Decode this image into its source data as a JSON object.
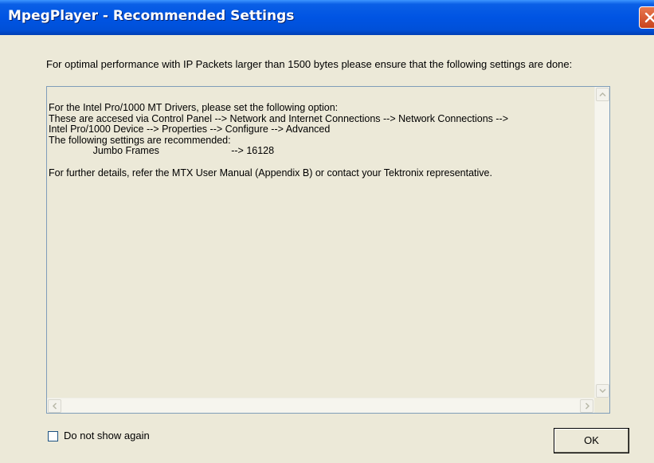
{
  "window": {
    "title": "MpegPlayer - Recommended Settings"
  },
  "message": "For optimal performance with IP Packets larger than 1500 bytes please ensure that the following settings are done:",
  "details": {
    "lines": [
      "For the Intel Pro/1000 MT Drivers, please set the following option:",
      "These are accesed via Control Panel --> Network and Internet Connections --> Network Connections -->",
      "Intel Pro/1000 Device --> Properties --> Configure --> Advanced",
      "The following settings are recommended:",
      "                Jumbo Frames                          --> 16128",
      "",
      "For further details, refer the MTX User Manual (Appendix B) or contact your Tektronix representative."
    ]
  },
  "checkbox": {
    "label": "Do not show again",
    "checked": false
  },
  "ok_button": {
    "label": "OK"
  },
  "icons": {
    "close": "close-icon",
    "scroll_up": "chevron-up-icon",
    "scroll_down": "chevron-down-icon",
    "scroll_left": "chevron-left-icon",
    "scroll_right": "chevron-right-icon"
  },
  "colors": {
    "titlebar": "#0054E3",
    "close_button": "#D6572B",
    "dialog_bg": "#ECE9D8",
    "border": "#7F9DB9"
  }
}
